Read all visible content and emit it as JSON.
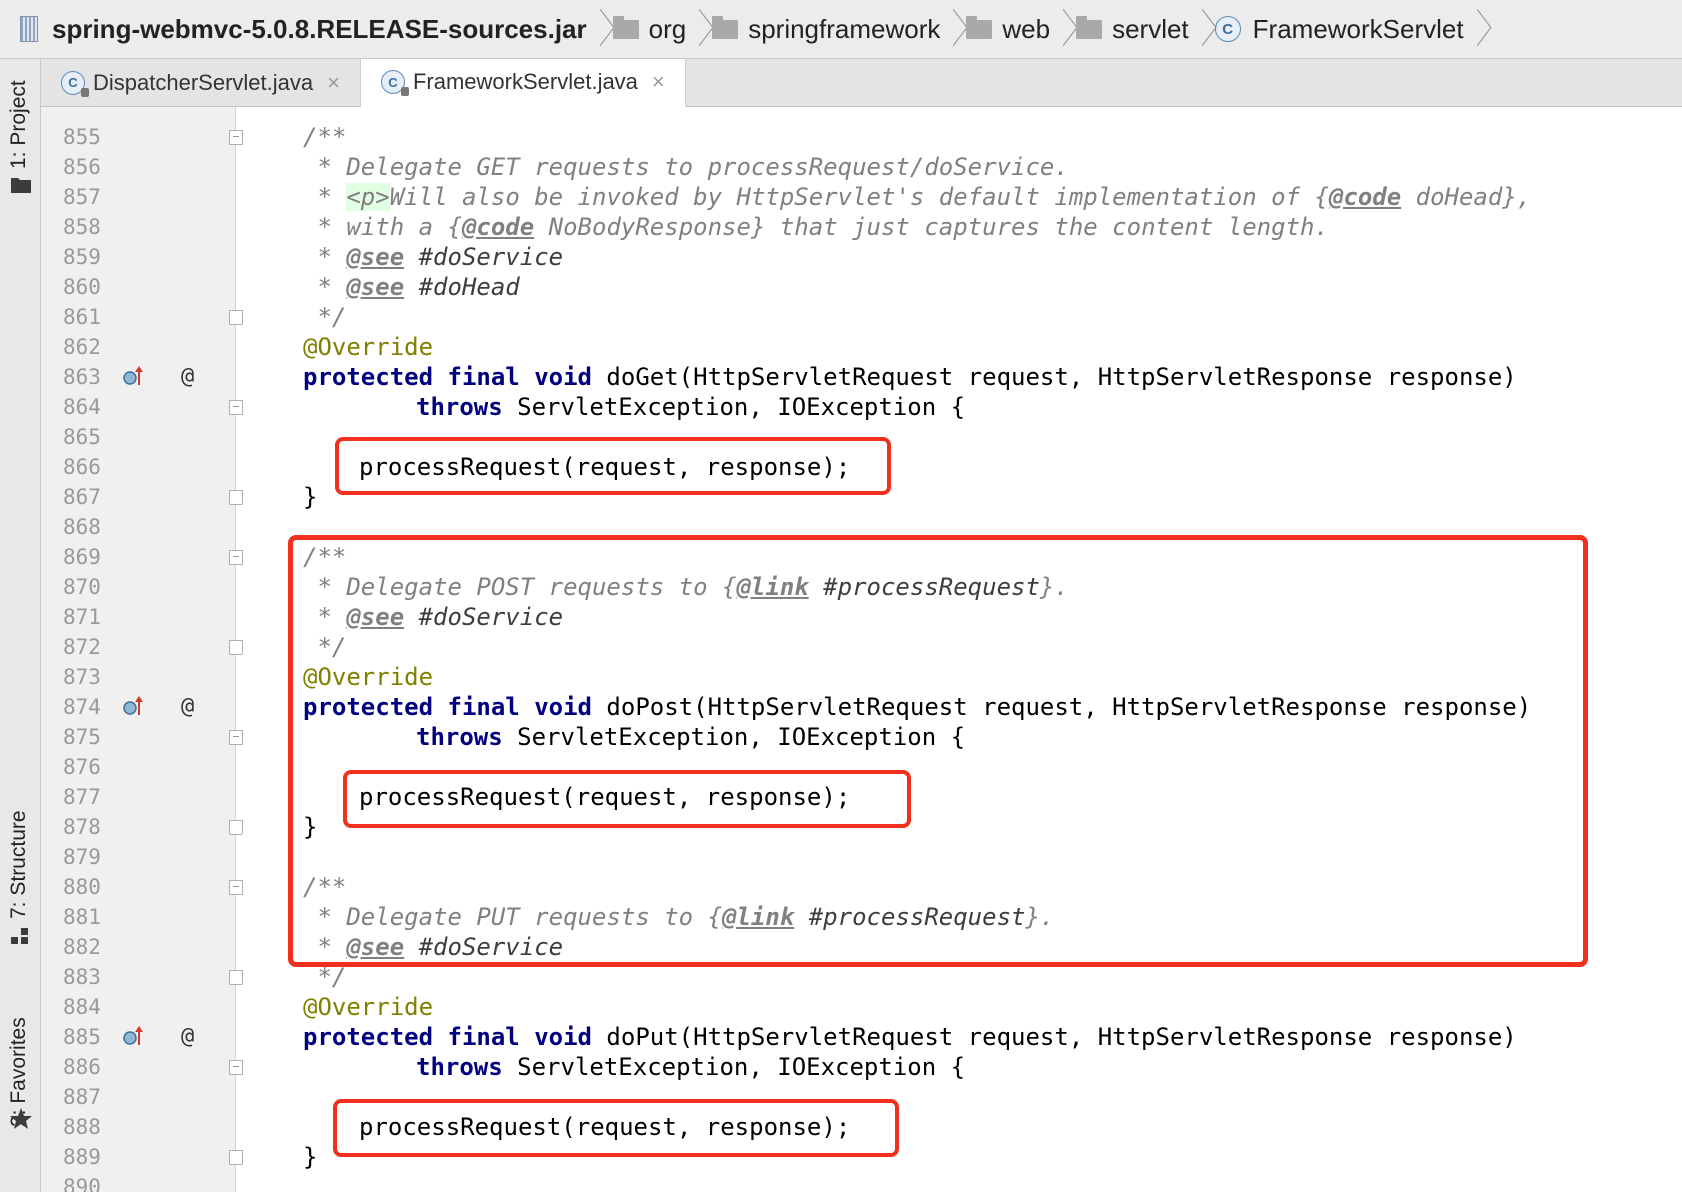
{
  "breadcrumb": [
    {
      "label": "spring-webmvc-5.0.8.RELEASE-sources.jar",
      "icon": "jar-icon"
    },
    {
      "label": "org",
      "icon": "folder-icon"
    },
    {
      "label": "springframework",
      "icon": "folder-icon"
    },
    {
      "label": "web",
      "icon": "folder-icon"
    },
    {
      "label": "servlet",
      "icon": "folder-icon"
    },
    {
      "label": "FrameworkServlet",
      "icon": "class-icon"
    }
  ],
  "tool_windows": {
    "project": "1: Project",
    "structure": "7: Structure",
    "favorites": "2: Favorites"
  },
  "tabs": [
    {
      "label": "DispatcherServlet.java",
      "active": false
    },
    {
      "label": "FrameworkServlet.java",
      "active": true
    }
  ],
  "tab_close_glyph": "×",
  "colors": {
    "keyword": "#000080",
    "comment": "#808080",
    "annotation": "#808000",
    "highlight_box": "#f0301c"
  },
  "code": {
    "doGet": {
      "l855": "/**",
      "l856": " * Delegate GET requests to processRequest/doService.",
      "l857a": " * ",
      "l857tag": "<p>",
      "l857b": "Will also be invoked by HttpServlet's default implementation of {",
      "l857code": "@code",
      "l857c": " doHead},",
      "l858a": " * with a {",
      "l858code": "@code",
      "l858b": " NoBodyResponse} that just captures the content length.",
      "l859a": " * ",
      "l859see": "@see",
      "l859ref": " #doService",
      "l860a": " * ",
      "l860see": "@see",
      "l860ref": " #doHead",
      "l861": " */",
      "l862": "@Override",
      "l863kw": "protected final void",
      "l863rest": " doGet(HttpServletRequest request, HttpServletResponse response)",
      "l864kw": "throws",
      "l864rest": " ServletException, IOException {",
      "l866": "processRequest(request, response);",
      "l867": "}"
    },
    "doPost": {
      "l869": "/**",
      "l870a": " * Delegate POST requests to {",
      "l870link": "@link",
      "l870ref": " #processRequest",
      "l870b": "}.",
      "l871a": " * ",
      "l871see": "@see",
      "l871ref": " #doService",
      "l872": " */",
      "l873": "@Override",
      "l874kw": "protected final void",
      "l874rest": " doPost(HttpServletRequest request, HttpServletResponse response)",
      "l875kw": "throws",
      "l875rest": " ServletException, IOException {",
      "l877": "processRequest(request, response);",
      "l878": "}"
    },
    "doPut": {
      "l880": "/**",
      "l881a": " * Delegate PUT requests to {",
      "l881link": "@link",
      "l881ref": " #processRequest",
      "l881b": "}.",
      "l882a": " * ",
      "l882see": "@see",
      "l882ref": " #doService",
      "l883": " */",
      "l884": "@Override",
      "l885kw": "protected final void",
      "l885rest": " doPut(HttpServletRequest request, HttpServletResponse response)",
      "l886kw": "throws",
      "l886rest": " ServletException, IOException {",
      "l888": "processRequest(request, response);",
      "l889": "}"
    }
  },
  "line_numbers": [
    "855",
    "856",
    "857",
    "858",
    "859",
    "860",
    "861",
    "862",
    "863",
    "864",
    "865",
    "866",
    "867",
    "868",
    "869",
    "870",
    "871",
    "872",
    "873",
    "874",
    "875",
    "876",
    "877",
    "878",
    "879",
    "880",
    "881",
    "882",
    "883",
    "884",
    "885",
    "886",
    "887",
    "888",
    "889",
    "890"
  ],
  "gutter_at": "@"
}
